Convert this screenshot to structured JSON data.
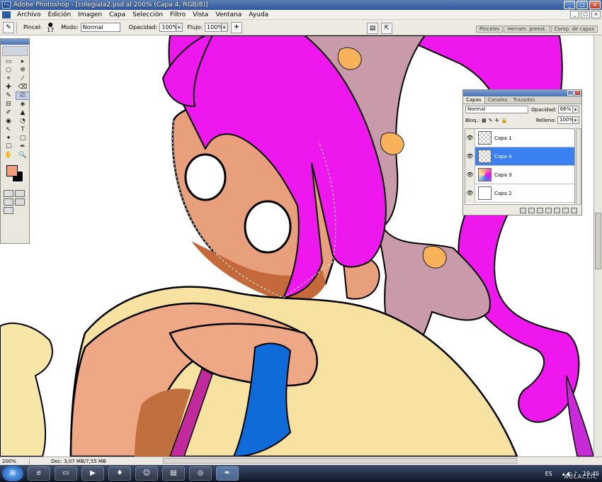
{
  "window": {
    "title": "Adobe Photoshop - [colegiala2.psd al 200% (Capa 4, RGB/8)]",
    "controls": [
      "_",
      "□",
      "×"
    ]
  },
  "menubar": {
    "items": [
      "Archivo",
      "Edición",
      "Imagen",
      "Capa",
      "Selección",
      "Filtro",
      "Vista",
      "Ventana",
      "Ayuda"
    ]
  },
  "options": {
    "brush_label": "Pincel:",
    "brush_size": "17",
    "mode_label": "Modo:",
    "mode_value": "Normal",
    "opacity_label": "Opacidad:",
    "opacity_value": "100%",
    "flow_label": "Flujo:",
    "flow_value": "100%",
    "palette_tabs": [
      "Pinceles",
      "Herram. preest.",
      "Comp. de capas"
    ]
  },
  "toolbox": {
    "foreground_color": "#f0a07a",
    "background_color": "#000000",
    "tools": [
      "▭",
      "▸",
      "○",
      "✲",
      "⌖",
      "⁄",
      "✚",
      "⌫",
      "✎",
      "⎚",
      "⊟",
      "◈",
      "✐",
      "▲",
      "◉",
      "◔",
      "↖",
      "T",
      "✦",
      "▢",
      "☐",
      "✒",
      "✋",
      "🔍"
    ]
  },
  "layers_panel": {
    "tabs": [
      "Capas",
      "Canales",
      "Trazados"
    ],
    "blend_mode": "Normal",
    "opacity_label": "Opacidad:",
    "opacity_value": "66%",
    "lock_label": "Bloq.:",
    "fill_label": "Relleno:",
    "fill_value": "100%",
    "layers": [
      {
        "name": "Capa 1",
        "active": false,
        "thumb": "transparent"
      },
      {
        "name": "Capa 4",
        "active": true,
        "thumb": "transparent"
      },
      {
        "name": "Capa 3",
        "active": false,
        "thumb": "colored"
      },
      {
        "name": "Capa 2",
        "active": false,
        "thumb": "white"
      }
    ]
  },
  "statusbar": {
    "zoom": "200%",
    "doc_info": "Doc: 3,07 MB/7,55 MB"
  },
  "taskbar": {
    "language": "ES",
    "time": "19:45"
  },
  "watermark": "AULACLIC"
}
